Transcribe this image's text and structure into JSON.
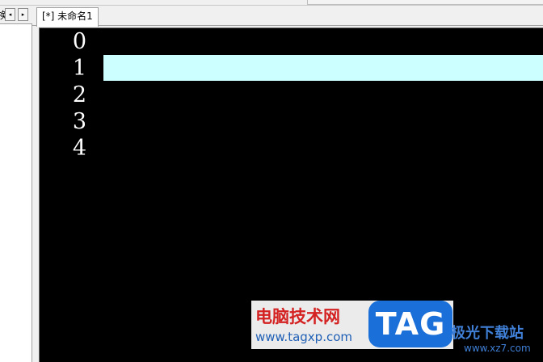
{
  "left_panel": {
    "cut_label": "换",
    "nav_prev_icon": "◂",
    "nav_next_icon": "▸"
  },
  "tabs": [
    {
      "label": "[*] 未命名1",
      "active": true
    }
  ],
  "editor": {
    "background": "#000000",
    "current_line_color": "#ccffff",
    "line_numbers": [
      "0",
      "1",
      "2",
      "3",
      "4"
    ],
    "current_line": "1"
  },
  "watermark": {
    "title": "电脑技术网",
    "url": "www.tagxp.com",
    "logo_text": "TAG",
    "site_name": "极光下载站",
    "site_url": "www.xz7.com"
  }
}
